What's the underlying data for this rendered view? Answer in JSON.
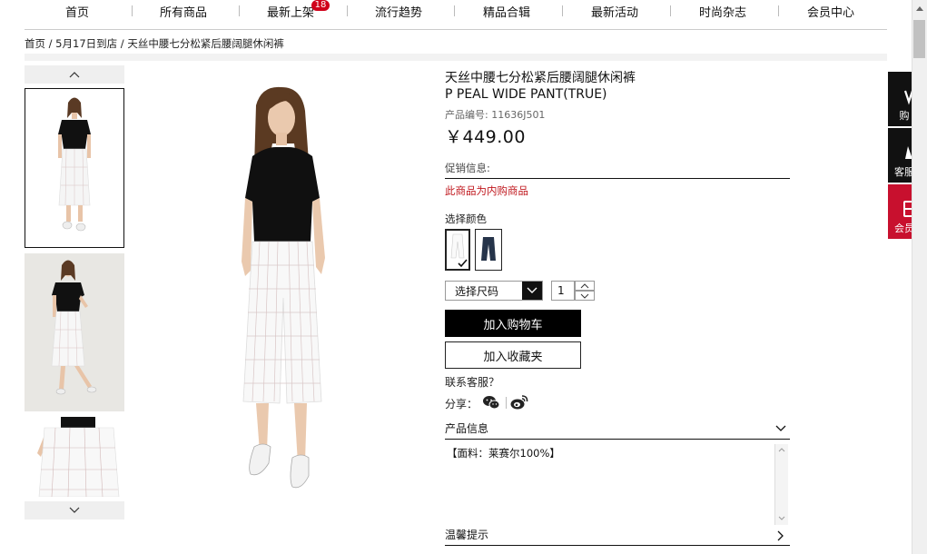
{
  "nav": {
    "items": [
      {
        "label": "首页"
      },
      {
        "label": "所有商品"
      },
      {
        "label": "最新上架",
        "badge": "18"
      },
      {
        "label": "流行趋势"
      },
      {
        "label": "精品合辑"
      },
      {
        "label": "最新活动"
      },
      {
        "label": "时尚杂志"
      },
      {
        "label": "会员中心"
      }
    ]
  },
  "breadcrumb": {
    "text": "首页 / 5月17日到店 / 天丝中腰七分松紧后腰阔腿休闲裤"
  },
  "product": {
    "title_cn": "天丝中腰七分松紧后腰阔腿休闲裤",
    "title_en": "P PEAL WIDE PANT(TRUE)",
    "sku": "产品编号: 11636J501",
    "price": "￥449.00",
    "promo_label": "促销信息:",
    "promo_text": "此商品为内购商品",
    "color_label": "选择颜色",
    "colors": [
      {
        "name": "white",
        "hex": "#ffffff",
        "selected": true
      },
      {
        "name": "navy",
        "hex": "#26344a",
        "selected": false
      }
    ],
    "size_placeholder": "选择尺码",
    "quantity": "1",
    "add_to_cart": "加入购物车",
    "add_to_favorites": "加入收藏夹",
    "contact": "联系客服？",
    "share_label": "分享：",
    "share_icons": [
      "wechat-icon",
      "weibo-icon"
    ],
    "info_title": "产品信息",
    "info_text": "【面料：莱赛尔100%】",
    "tips_title": "温馨提示"
  },
  "sidebar": {
    "items": [
      {
        "label": "购",
        "icon": "cart-icon",
        "color": "#111111"
      },
      {
        "label": "客服",
        "icon": "service-icon",
        "color": "#111111"
      },
      {
        "label": "会员",
        "icon": "member-icon",
        "color": "#c8102e"
      }
    ]
  },
  "colors": {
    "accent": "#c0181e",
    "badge": "#d0021b",
    "button": "#000000"
  }
}
